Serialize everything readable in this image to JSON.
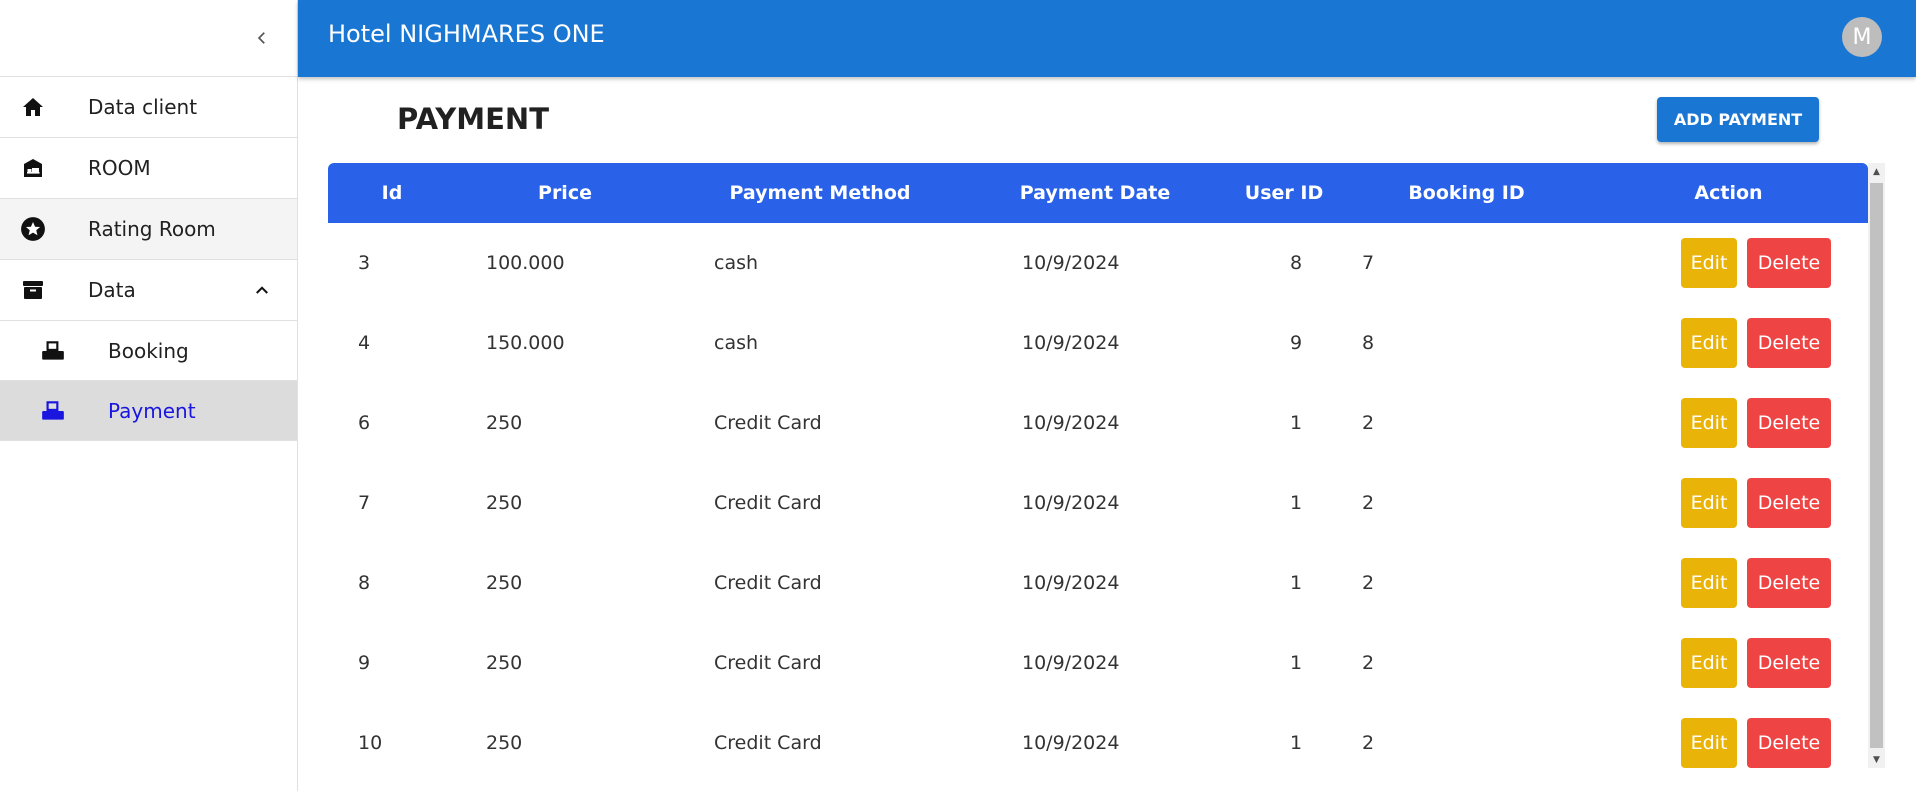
{
  "app": {
    "title": "Hotel NIGHMARES ONE",
    "avatar_initial": "M"
  },
  "sidebar": {
    "items": [
      {
        "label": "Data client",
        "icon": "home-icon"
      },
      {
        "label": "ROOM",
        "icon": "hotel-icon"
      },
      {
        "label": "Rating Room",
        "icon": "star-circle-icon"
      },
      {
        "label": "Data",
        "icon": "archive-icon",
        "expanded": true
      }
    ],
    "subitems": [
      {
        "label": "Booking",
        "icon": "fax-icon"
      },
      {
        "label": "Payment",
        "icon": "fax-icon",
        "active": true
      }
    ]
  },
  "main": {
    "title": "PAYMENT",
    "add_button": "ADD PAYMENT",
    "table": {
      "columns": [
        "Id",
        "Price",
        "Payment Method",
        "Payment Date",
        "User ID",
        "Booking ID",
        "Action"
      ],
      "rows": [
        [
          "3",
          "100.000",
          "cash",
          "10/9/2024",
          "8",
          "7"
        ],
        [
          "4",
          "150.000",
          "cash",
          "10/9/2024",
          "9",
          "8"
        ],
        [
          "6",
          "250",
          "Credit Card",
          "10/9/2024",
          "1",
          "2"
        ],
        [
          "7",
          "250",
          "Credit Card",
          "10/9/2024",
          "1",
          "2"
        ],
        [
          "8",
          "250",
          "Credit Card",
          "10/9/2024",
          "1",
          "2"
        ],
        [
          "9",
          "250",
          "Credit Card",
          "10/9/2024",
          "1",
          "2"
        ],
        [
          "10",
          "250",
          "Credit Card",
          "10/9/2024",
          "1",
          "2"
        ]
      ],
      "edit_label": "Edit",
      "delete_label": "Delete"
    }
  },
  "colors": {
    "appbar": "#1976d2",
    "table_header": "#2962e8",
    "edit": "#eab308",
    "delete": "#ef4444",
    "active_link": "#1a16e0"
  }
}
